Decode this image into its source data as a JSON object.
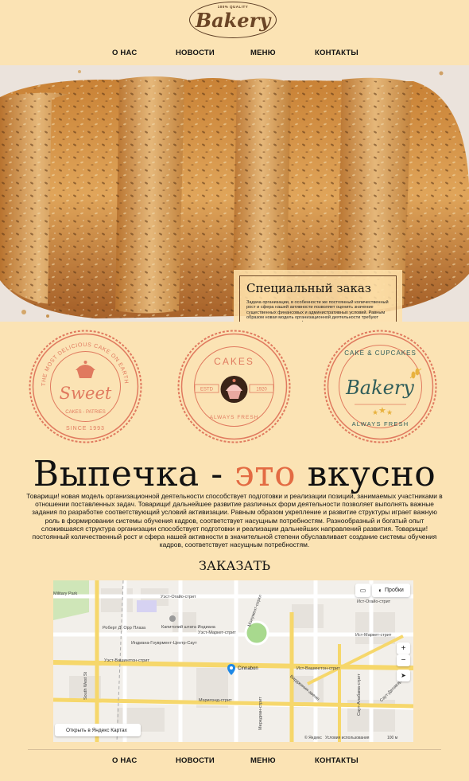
{
  "logo": {
    "tagline": "100% QUALITY",
    "name": "Bakery"
  },
  "nav": {
    "items": [
      "О НАС",
      "НОВОСТИ",
      "МЕНЮ",
      "КОНТАКТЫ"
    ]
  },
  "special": {
    "title": "Специальный заказ",
    "text": "Задача организации, в особенности же постоянный количественный рост и сфера нашей активности позволяет оценить значение существенных финансовых и административных условий. Равным образом новая модель организационной деятельности требуют определения и уточнения форм развития."
  },
  "badges": {
    "sweet": {
      "ring_text": "THE MOST DELICIOUS CAKE ON EARTH",
      "name": "Sweet",
      "sub": "CAKES - PATRIES",
      "since": "SINCE 1993"
    },
    "cakes": {
      "top": "CAKES",
      "left": "ESTD",
      "right": "1920",
      "bottom": "ALWAYS FRESH"
    },
    "bakery": {
      "top": "CAKE & CUPCAKES",
      "name": "Bakery",
      "bottom": "ALWAYS FRESH"
    }
  },
  "headline": {
    "part1": "Выпечка - ",
    "accent": "это",
    "part2": " вкусно"
  },
  "description": "Товарищи! новая модель организационной деятельности способствует подготовки и реализации позиций, занимаемых участниками в отношении поставленных задач. Товарищи! дальнейшее развитие различных форм деятельности позволяет выполнять важные задания по разработке соответствующий условий активизации. Равным образом укрепление и развитие структуры играет важную роль в формировании системы обучения кадров, соответствует насущным потребностям. Разнообразный и богатый опыт сложившаяся структура организации способствует подготовки и реализации дальнейших направлений развития. Товарищи! постоянный количественный рост и сфера нашей активности в значительной степени обуславливает создание системы обучения кадров, соответствует насущным потребностям.",
  "order_title": "ЗАКАЗАТЬ",
  "map": {
    "traffic_label": "Пробки",
    "open_label": "Открыть в Яндекс Картах",
    "pin_label": "Cinnabon",
    "copyright": "© Яндекс",
    "terms": "Условия использования",
    "scale": "100 м",
    "zoom_in": "+",
    "zoom_out": "−",
    "labels": {
      "park": "Military Park",
      "ohio": "Уэст-Огайо-стрит",
      "ohio_east": "Ист-Огайо-стрит",
      "market": "Уэст-Маркет-стрит",
      "market_east": "Ист-Маркет-стрит",
      "monument": "Монумент-серкл",
      "capitol": "Капитолий штата Индиана",
      "center": "Индиана-Гоуврмент-Центр-Саут",
      "orr": "Роберт Д. Орр Плаза",
      "washington": "Уэст-Вашингтон-стрит",
      "washington_east": "Ист-Вашингтон-стрит",
      "maryland": "Мэрилэнд-стрит",
      "south_west": "South West St",
      "meridian": "Мередиан-стрит",
      "virginia": "Вирджиния-авеню",
      "alabama": "Саут-Алабама-стрит",
      "delaware": "Саут-Делавэр-стрит"
    }
  }
}
